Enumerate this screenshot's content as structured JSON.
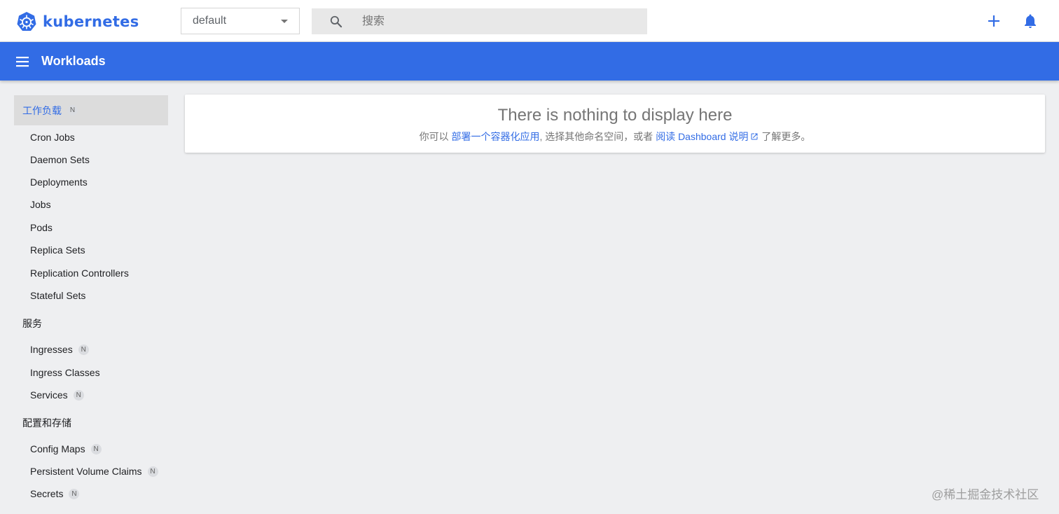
{
  "header": {
    "logo_text": "kubernetes",
    "namespace_value": "default",
    "search_placeholder": "搜索",
    "brand_color": "#326ce5"
  },
  "toolbar": {
    "title": "Workloads"
  },
  "sidebar": {
    "categories": [
      {
        "label": "工作负载",
        "badge": "N",
        "active": true
      },
      {
        "label": "服务"
      },
      {
        "label": "配置和存储"
      }
    ],
    "workload_items": [
      "Cron Jobs",
      "Daemon Sets",
      "Deployments",
      "Jobs",
      "Pods",
      "Replica Sets",
      "Replication Controllers",
      "Stateful Sets"
    ],
    "service_items": [
      {
        "label": "Ingresses",
        "badge": "N"
      },
      {
        "label": "Ingress Classes"
      },
      {
        "label": "Services",
        "badge": "N"
      }
    ],
    "config_items": [
      {
        "label": "Config Maps",
        "badge": "N"
      },
      {
        "label": "Persistent Volume Claims",
        "badge": "N"
      },
      {
        "label": "Secrets",
        "badge": "N"
      }
    ]
  },
  "empty_state": {
    "title": "There is nothing to display here",
    "prefix": "你可以 ",
    "deploy_link": "部署一个容器化应用",
    "middle": ", 选择其他命名空间，或者 ",
    "docs_link": "阅读 Dashboard 说明",
    "suffix": " 了解更多。"
  },
  "watermark": "@稀土掘金技术社区",
  "icons": {
    "logo": "kubernetes-logo-icon",
    "search": "search-icon",
    "add": "plus-icon",
    "notifications": "bell-icon",
    "menu": "hamburger-menu-icon",
    "external": "external-link-icon"
  }
}
